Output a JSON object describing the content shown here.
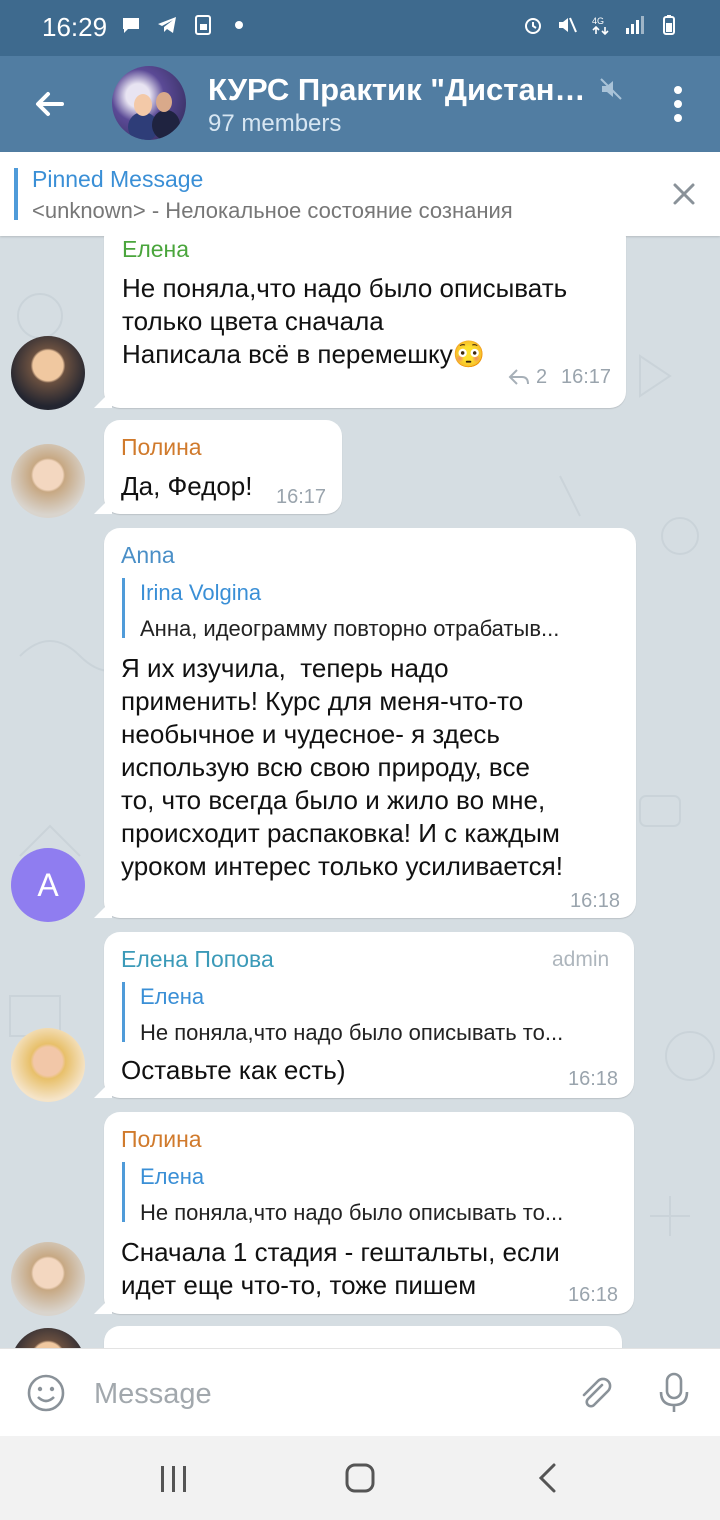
{
  "status_bar": {
    "time": "16:29",
    "network": "4G",
    "left_icons": [
      "chat-bubble-icon",
      "telegram-icon",
      "sim-icon",
      "dot-icon"
    ],
    "right_icons": [
      "alarm-icon",
      "mute-icon",
      "data-arrows-icon",
      "signal-icon",
      "battery-icon"
    ]
  },
  "header": {
    "title": "КУРС Практик \"Дистанц...",
    "subtitle": "97 members",
    "colors": {
      "bar": "#517da2",
      "status": "#3e6a8e"
    }
  },
  "pinned": {
    "title": "Pinned Message",
    "text": "<unknown> - Нелокальное состояние сознания"
  },
  "messages": [
    {
      "sender": "Елена",
      "sender_color": "#4aa53c",
      "text": "Не поняла,что надо было описывать\nтолько цвета сначала\nНаписала всё в перемешку😳",
      "reply_count": "2",
      "time": "16:17"
    },
    {
      "sender": "Полина",
      "sender_color": "#d07a2c",
      "text": "Да, Федор!",
      "time": "16:17"
    },
    {
      "sender": "Anna",
      "sender_color": "#4a8fc7",
      "avatar_letter": "A",
      "reply": {
        "name": "Irina Volgina",
        "text": "Анна, идеограмму повторно отрабатыв..."
      },
      "text": "Я их изучила,  теперь надо\nприменить! Курс для меня-что-то\nнеобычное и чудесное- я здесь\nиспользую всю свою природу, все\nто, что всегда было и жило во мне,\nпроисходит распаковка! И с каждым\nуроком интерес только усиливается!",
      "time": "16:18"
    },
    {
      "sender": "Елена Попова",
      "sender_color": "#3b9ab8",
      "badge": "admin",
      "reply": {
        "name": "Елена",
        "text": "Не поняла,что надо было описывать то..."
      },
      "text": "Оставьте как есть)",
      "time": "16:18"
    },
    {
      "sender": "Полина",
      "sender_color": "#d07a2c",
      "reply": {
        "name": "Елена",
        "text": "Не поняла,что надо было описывать то..."
      },
      "text": "Сначала 1 стадия - гештальты, если\nидет еще что-то, тоже пишем",
      "time": "16:18"
    }
  ],
  "composer": {
    "placeholder": "Message"
  }
}
